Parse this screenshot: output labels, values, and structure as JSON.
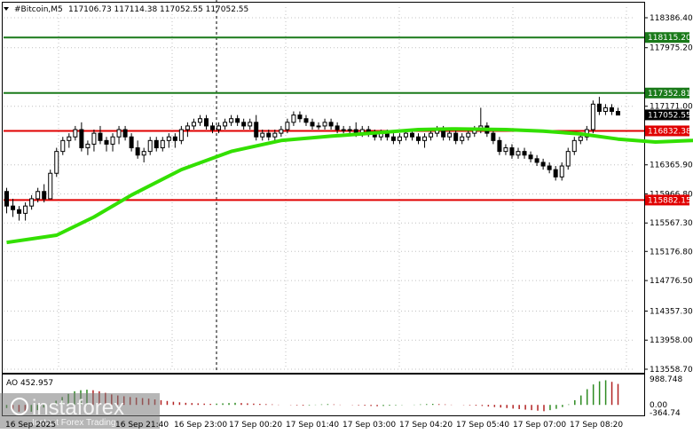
{
  "header": {
    "icon": "triangle-down-icon",
    "symbol": "#Bitcoin,M5",
    "ohlc": "117106.73 117114.38 117052.55 117052.55"
  },
  "colors": {
    "background": "#ffffff",
    "grid": "#c0c0c0",
    "candle": "#000000",
    "ma": "#33e000",
    "level_green": "#1a7a1a",
    "level_red": "#e00000",
    "ao_up": "#2e8b22",
    "ao_down": "#b22222",
    "price_tag_bg": "#000000"
  },
  "price_axis_labels": [
    "118386.40",
    "117975.20",
    "117171.00",
    "116365.90",
    "115966.80",
    "115567.30",
    "115176.80",
    "114776.50",
    "114357.30",
    "113958.00",
    "113558.70"
  ],
  "levels": [
    {
      "price": 118115.2,
      "label": "118115.20",
      "color": "#1a7a1a"
    },
    {
      "price": 117352.81,
      "label": "117352.81",
      "color": "#1a7a1a"
    },
    {
      "price": 116832.38,
      "label": "116832.38",
      "color": "#e00000"
    },
    {
      "price": 115882.15,
      "label": "115882.15",
      "color": "#e00000"
    }
  ],
  "current_price": {
    "price": 117052.55,
    "label": "117052.55"
  },
  "indicator": {
    "title": "AO 452.957",
    "axis_labels": [
      "988.748",
      "0.00",
      "-364.74"
    ]
  },
  "time_labels": [
    "16 Sep 2025",
    "16 Sep 21:40",
    "16 Sep 23:00",
    "17 Sep 00:20",
    "17 Sep 01:40",
    "17 Sep 03:00",
    "17 Sep 04:20",
    "17 Sep 05:40",
    "17 Sep 07:00",
    "17 Sep 08:20"
  ],
  "watermark": {
    "brand": "instaforex",
    "tagline": "Instant Forex Trading"
  },
  "chart_data": {
    "type": "candlestick",
    "ylim": [
      113558.7,
      118386.4
    ],
    "candles": [
      [
        116000,
        116050,
        115700,
        115800
      ],
      [
        115800,
        115900,
        115650,
        115750
      ],
      [
        115750,
        115800,
        115600,
        115700
      ],
      [
        115700,
        115850,
        115600,
        115800
      ],
      [
        115800,
        115950,
        115750,
        115900
      ],
      [
        115900,
        116050,
        115850,
        116000
      ],
      [
        116000,
        116100,
        115850,
        115900
      ],
      [
        115900,
        116300,
        115900,
        116250
      ],
      [
        116250,
        116600,
        116200,
        116550
      ],
      [
        116550,
        116750,
        116500,
        116700
      ],
      [
        116700,
        116800,
        116600,
        116750
      ],
      [
        116750,
        116900,
        116700,
        116850
      ],
      [
        116850,
        116950,
        116550,
        116600
      ],
      [
        116600,
        116700,
        116500,
        116650
      ],
      [
        116650,
        116850,
        116550,
        116800
      ],
      [
        116800,
        116900,
        116650,
        116700
      ],
      [
        116700,
        116750,
        116550,
        116650
      ],
      [
        116650,
        116800,
        116550,
        116750
      ],
      [
        116750,
        116900,
        116650,
        116850
      ],
      [
        116850,
        116900,
        116700,
        116750
      ],
      [
        116750,
        116800,
        116550,
        116600
      ],
      [
        116600,
        116700,
        116450,
        116500
      ],
      [
        116500,
        116600,
        116400,
        116550
      ],
      [
        116550,
        116750,
        116500,
        116700
      ],
      [
        116700,
        116750,
        116550,
        116600
      ],
      [
        116600,
        116750,
        116550,
        116700
      ],
      [
        116700,
        116800,
        116600,
        116750
      ],
      [
        116750,
        116800,
        116600,
        116700
      ],
      [
        116700,
        116900,
        116650,
        116850
      ],
      [
        116850,
        116950,
        116750,
        116900
      ],
      [
        116900,
        117000,
        116850,
        116950
      ],
      [
        116950,
        117050,
        116900,
        117000
      ],
      [
        117000,
        117050,
        116850,
        116900
      ],
      [
        116900,
        116950,
        116800,
        116850
      ],
      [
        116850,
        116950,
        116800,
        116900
      ],
      [
        116900,
        117000,
        116850,
        116950
      ],
      [
        116950,
        117050,
        116900,
        117000
      ],
      [
        117000,
        117050,
        116900,
        116950
      ],
      [
        116950,
        117000,
        116850,
        116900
      ],
      [
        116900,
        117000,
        116850,
        116950
      ],
      [
        116950,
        117050,
        116700,
        116750
      ],
      [
        116750,
        116850,
        116700,
        116800
      ],
      [
        116800,
        116850,
        116700,
        116750
      ],
      [
        116750,
        116850,
        116700,
        116800
      ],
      [
        116800,
        116900,
        116750,
        116850
      ],
      [
        116850,
        117000,
        116800,
        116950
      ],
      [
        116950,
        117100,
        116900,
        117050
      ],
      [
        117050,
        117100,
        116950,
        117000
      ],
      [
        117000,
        117050,
        116900,
        116950
      ],
      [
        116950,
        117000,
        116850,
        116900
      ],
      [
        116900,
        116950,
        116850,
        116900
      ],
      [
        116900,
        117000,
        116850,
        116950
      ],
      [
        116950,
        117000,
        116850,
        116900
      ],
      [
        116900,
        116950,
        116800,
        116850
      ],
      [
        116850,
        116900,
        116800,
        116850
      ],
      [
        116850,
        116900,
        116800,
        116850
      ],
      [
        116850,
        116950,
        116750,
        116800
      ],
      [
        116800,
        116900,
        116750,
        116850
      ],
      [
        116850,
        116900,
        116750,
        116800
      ],
      [
        116800,
        116850,
        116700,
        116750
      ],
      [
        116750,
        116850,
        116700,
        116800
      ],
      [
        116800,
        116850,
        116700,
        116750
      ],
      [
        116750,
        116800,
        116650,
        116700
      ],
      [
        116700,
        116800,
        116650,
        116750
      ],
      [
        116750,
        116850,
        116700,
        116800
      ],
      [
        116800,
        116850,
        116700,
        116750
      ],
      [
        116750,
        116800,
        116650,
        116700
      ],
      [
        116700,
        116800,
        116600,
        116750
      ],
      [
        116750,
        116850,
        116700,
        116800
      ],
      [
        116800,
        116900,
        116750,
        116850
      ],
      [
        116850,
        116900,
        116700,
        116750
      ],
      [
        116750,
        116850,
        116700,
        116800
      ],
      [
        116800,
        116850,
        116650,
        116700
      ],
      [
        116700,
        116800,
        116650,
        116750
      ],
      [
        116750,
        116850,
        116700,
        116800
      ],
      [
        116800,
        116900,
        116750,
        116850
      ],
      [
        116850,
        117150,
        116800,
        116900
      ],
      [
        116900,
        116950,
        116750,
        116800
      ],
      [
        116800,
        116850,
        116650,
        116700
      ],
      [
        116700,
        116750,
        116500,
        116550
      ],
      [
        116550,
        116650,
        116500,
        116600
      ],
      [
        116600,
        116650,
        116450,
        116500
      ],
      [
        116500,
        116600,
        116450,
        116550
      ],
      [
        116550,
        116600,
        116450,
        116500
      ],
      [
        116500,
        116550,
        116400,
        116450
      ],
      [
        116450,
        116500,
        116350,
        116400
      ],
      [
        116400,
        116450,
        116300,
        116350
      ],
      [
        116350,
        116400,
        116250,
        116300
      ],
      [
        116300,
        116350,
        116150,
        116200
      ],
      [
        116200,
        116400,
        116150,
        116350
      ],
      [
        116350,
        116600,
        116300,
        116550
      ],
      [
        116550,
        116750,
        116500,
        116700
      ],
      [
        116700,
        116800,
        116650,
        116750
      ],
      [
        116750,
        116900,
        116700,
        116850
      ],
      [
        116850,
        117250,
        116800,
        117200
      ],
      [
        117200,
        117300,
        117050,
        117100
      ],
      [
        117100,
        117200,
        117050,
        117150
      ],
      [
        117150,
        117200,
        117050,
        117100
      ],
      [
        117100,
        117150,
        117050,
        117050
      ]
    ],
    "moving_average": [
      [
        0,
        115300
      ],
      [
        8,
        115400
      ],
      [
        14,
        115650
      ],
      [
        20,
        115950
      ],
      [
        28,
        116300
      ],
      [
        36,
        116550
      ],
      [
        44,
        116700
      ],
      [
        52,
        116760
      ],
      [
        60,
        116810
      ],
      [
        66,
        116850
      ],
      [
        72,
        116860
      ],
      [
        80,
        116850
      ],
      [
        86,
        116830
      ],
      [
        92,
        116790
      ],
      [
        98,
        116720
      ],
      [
        104,
        116680
      ],
      [
        110,
        116700
      ],
      [
        116,
        116740
      ]
    ],
    "ao": [
      -120,
      -200,
      -260,
      -300,
      -260,
      -200,
      -100,
      20,
      160,
      300,
      420,
      520,
      560,
      580,
      560,
      520,
      460,
      400,
      360,
      330,
      300,
      280,
      260,
      240,
      210,
      180,
      150,
      120,
      100,
      80,
      70,
      60,
      50,
      40,
      50,
      60,
      70,
      80,
      70,
      60,
      50,
      40,
      30,
      20,
      10,
      0,
      -10,
      -20,
      -30,
      -20,
      10,
      20,
      30,
      20,
      10,
      0,
      -10,
      -20,
      -30,
      -40,
      -50,
      -40,
      -30,
      -20,
      -10,
      0,
      10,
      20,
      30,
      40,
      30,
      20,
      10,
      0,
      -10,
      -20,
      -30,
      -40,
      -60,
      -80,
      -100,
      -120,
      -140,
      -160,
      -180,
      -200,
      -220,
      -240,
      -200,
      -150,
      -80,
      20,
      180,
      360,
      600,
      780,
      900,
      940,
      880,
      800
    ]
  }
}
